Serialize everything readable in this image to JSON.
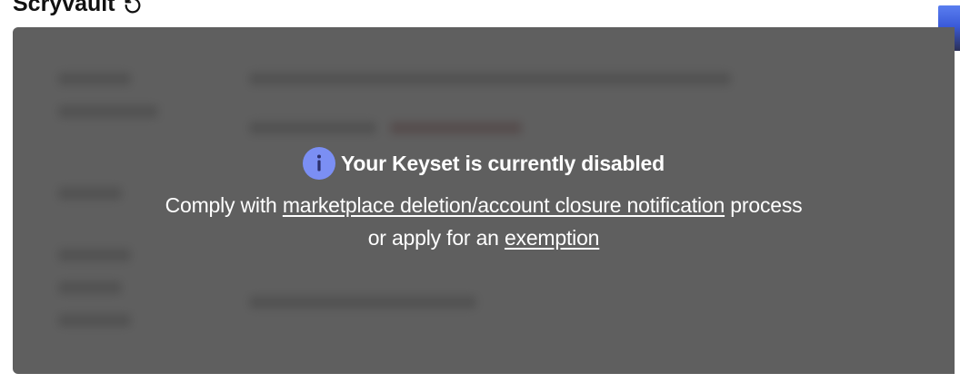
{
  "app": {
    "title": "Scryvault",
    "title_icon": "refresh-icon"
  },
  "notice": {
    "icon": "info-icon",
    "heading": "Your Keyset is currently disabled",
    "text_prefix": "Comply with",
    "link1": "marketplace deletion/account closure notification",
    "text_middle": "process",
    "text_line2": "or apply for an",
    "link2": "exemption"
  },
  "colors": {
    "accent": "#7b8ff4",
    "overlay": "#5c5c5c",
    "scroll_tab": "#3b5bd9"
  }
}
